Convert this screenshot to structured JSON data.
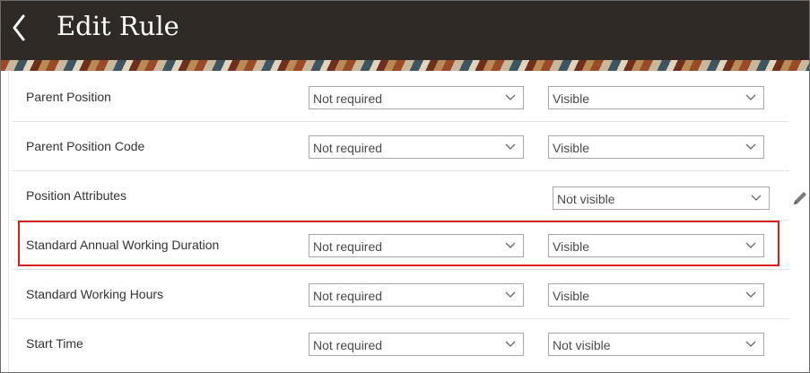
{
  "header": {
    "title": "Edit Rule",
    "back_icon": "chevron-left-icon",
    "background": "#302a26"
  },
  "rows": [
    {
      "label": "Parent Position",
      "required": "Not required",
      "visibility": "Visible"
    },
    {
      "label": "Parent Position Code",
      "required": "Not required",
      "visibility": "Visible"
    },
    {
      "label": "Position Attributes",
      "visibility": "Not visible",
      "edit_icon": "pencil-icon"
    },
    {
      "label": "Standard Annual Working Duration",
      "required": "Not required",
      "visibility": "Visible",
      "highlighted": true
    },
    {
      "label": "Standard Working Hours",
      "required": "Not required",
      "visibility": "Visible"
    },
    {
      "label": "Start Time",
      "required": "Not required",
      "visibility": "Not visible"
    }
  ],
  "colors": {
    "highlight": "#d62020",
    "text": "#333333",
    "select_border": "#a8a8a8"
  }
}
